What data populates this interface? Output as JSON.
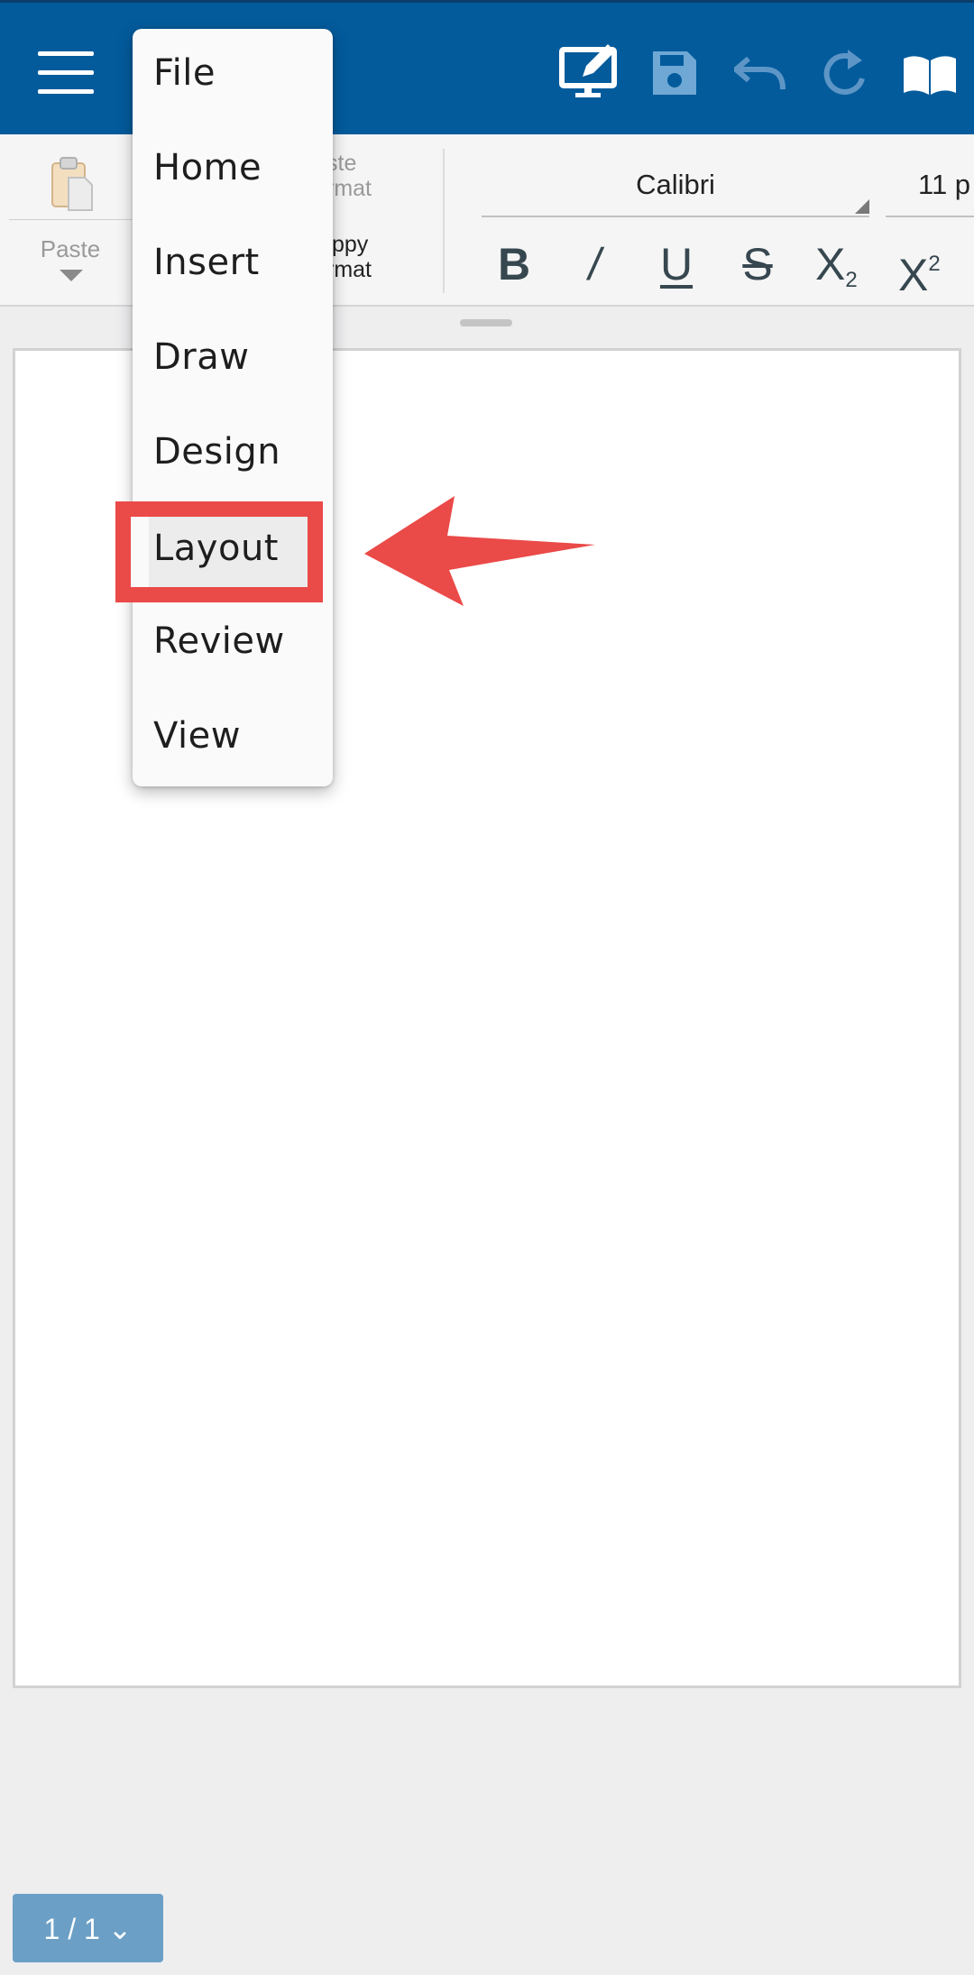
{
  "toolbar": {
    "icons": [
      "menu-icon",
      "desktop-edit-icon",
      "save-icon",
      "undo-icon",
      "redo-icon",
      "book-icon"
    ]
  },
  "ribbon": {
    "paste_label": "Paste",
    "paste_format_line1": "ste",
    "paste_format_line2": "rmat",
    "copy_format_line1": "ppy",
    "copy_format_line2": "rmat",
    "font_name": "Calibri",
    "font_size": "11 p",
    "format_buttons": {
      "bold": "B",
      "italic": "/",
      "underline": "U",
      "strike": "S",
      "subscript_base": "X",
      "subscript_mark": "2",
      "superscript_base": "X",
      "superscript_mark": "2"
    }
  },
  "menu": {
    "items": [
      {
        "label": "File"
      },
      {
        "label": "Home"
      },
      {
        "label": "Insert"
      },
      {
        "label": "Draw"
      },
      {
        "label": "Design"
      },
      {
        "label": "Layout",
        "highlighted": true
      },
      {
        "label": "Review"
      },
      {
        "label": "View"
      }
    ]
  },
  "page_indicator": {
    "text": "1 / 1 ⌄"
  },
  "colors": {
    "appbar": "#035b9c",
    "annotation": "#ea4a48",
    "page_indicator": "#6b9fc6"
  }
}
